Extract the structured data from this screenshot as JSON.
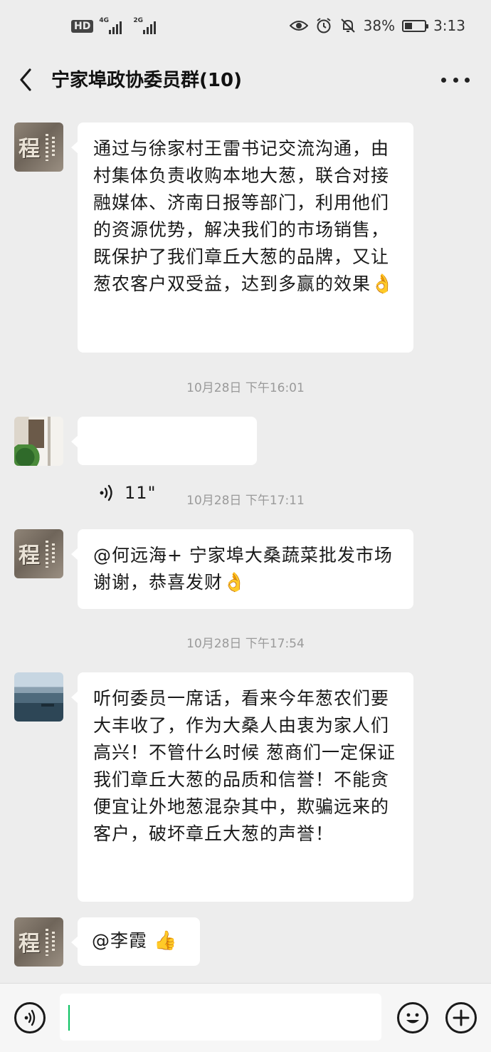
{
  "status_bar": {
    "hd": "HD",
    "signal1_label": "4G",
    "signal2_label": "2G",
    "battery_percent": "38%",
    "battery_level": 0.38,
    "time": "3:13",
    "icons": [
      "eye-icon",
      "alarm-icon",
      "mute-bell-icon",
      "battery-icon"
    ]
  },
  "header": {
    "title": "宁家埠政协委员群(10)",
    "back_icon": "chevron-left-icon",
    "more_icon": "more-dots-icon"
  },
  "messages": [
    {
      "type": "text",
      "avatar": "cheng-calligraphy",
      "text": "通过与徐家村王雷书记交流沟通，由村集体负责收购本地大葱，联合对接融媒体、济南日报等部门，利用他们的资源优势，解决我们的市场销售，既保护了我们章丘大葱的品牌，又让葱农客户双受益，达到多赢的效果",
      "emoji": "👌"
    },
    {
      "type": "timestamp",
      "text": "10月28日 下午16:01"
    },
    {
      "type": "voice",
      "avatar": "doorway-plant",
      "duration": "11\""
    },
    {
      "type": "timestamp",
      "text": "10月28日 下午17:11"
    },
    {
      "type": "text",
      "avatar": "cheng-calligraphy",
      "text": "@何远海+ 宁家埠大桑蔬菜批发市场  谢谢，恭喜发财",
      "emoji": "👌"
    },
    {
      "type": "timestamp",
      "text": "10月28日 下午17:54"
    },
    {
      "type": "text",
      "avatar": "lake-landscape",
      "text": "听何委员一席话，看来今年葱农们要大丰收了，作为大桑人由衷为家人们高兴！不管什么时候 葱商们一定保证我们章丘大葱的品质和信誉！不能贪便宜让外地葱混杂其中，欺骗远来的客户，破坏章丘大葱的声誉！",
      "emoji": ""
    },
    {
      "type": "text",
      "avatar": "cheng-calligraphy",
      "text": "@李霞",
      "emoji": "👍"
    }
  ],
  "input_bar": {
    "voice_icon": "voice-input-icon",
    "emoji_icon": "smiley-icon",
    "plus_icon": "plus-icon"
  },
  "colors": {
    "chat_background": "#ededed",
    "bubble": "#ffffff",
    "accent_cursor": "#07c160",
    "timestamp": "#9a9a9a"
  }
}
